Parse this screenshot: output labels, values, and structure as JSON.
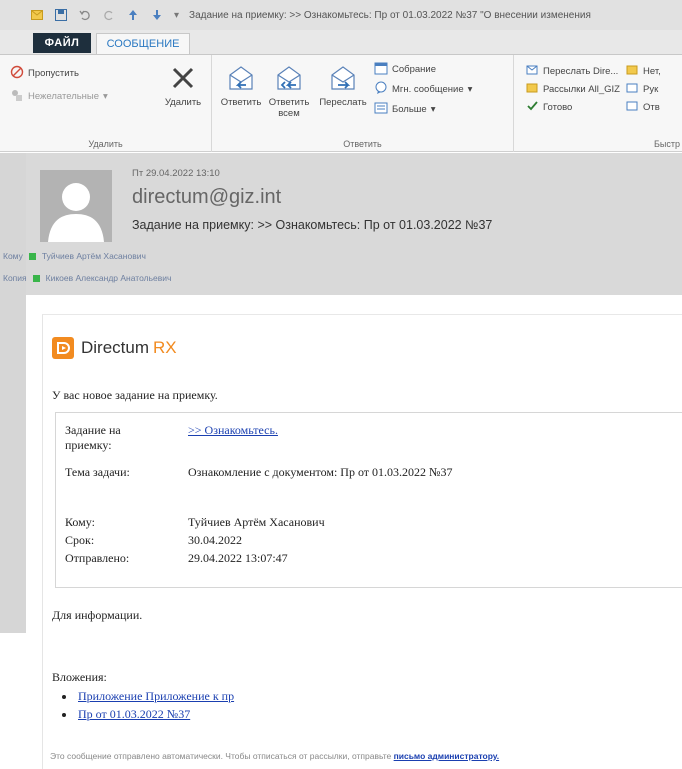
{
  "window": {
    "title": "Задание на приемку: >> Ознакомьтесь: Пр от 01.03.2022 №37 \"О внесении изменения"
  },
  "tabs": {
    "file": "ФАЙЛ",
    "message": "СООБЩЕНИЕ"
  },
  "ribbon": {
    "delete_group": {
      "ignore": "Пропустить",
      "junk": "Нежелательные",
      "delete": "Удалить",
      "label": "Удалить"
    },
    "respond_group": {
      "reply": "Ответить",
      "reply_all_1": "Ответить",
      "reply_all_2": "всем",
      "forward": "Переслать",
      "meeting": "Собрание",
      "im": "Мгн. сообщение",
      "more": "Больше",
      "label": "Ответить"
    },
    "quick_group": {
      "fwd_dir": "Переслать Dire...",
      "team": "Рассылки All_GIZ",
      "done": "Готово",
      "no": "Нет,",
      "lead": "Рук",
      "reply": "Отв",
      "label": "Быстр"
    }
  },
  "header": {
    "date": "Пт 29.04.2022 13:10",
    "sender": "directum@giz.int",
    "subject": "Задание на приемку: >> Ознакомьтесь: Пр от 01.03.2022 №37",
    "to_label": "Кому",
    "to_name": "Туйчиев Артём Хасанович",
    "cc_label": "Копия",
    "cc_name": "Кикоев Александр Анатольевич"
  },
  "body": {
    "logo_text": "Directum",
    "logo_rx": "RX",
    "intro": "У вас новое задание на приемку.",
    "task_label_1": "Задание на",
    "task_label_2": "приемку:",
    "task_link": ">> Ознакомьтесь.",
    "topic_label": "Тема задачи:",
    "topic_value": "Ознакомление с документом: Пр от 01.03.2022 №37",
    "to_label": "Кому:",
    "to_value": "Туйчиев Артём Хасанович",
    "due_label": "Срок:",
    "due_value": "30.04.2022",
    "sent_label": "Отправлено:",
    "sent_value": "29.04.2022 13:07:47",
    "info": "Для информации.",
    "attachments_title": "Вложения:",
    "attachments": [
      "Приложение Приложение к пр",
      "Пр от 01.03.2022 №37"
    ],
    "footer_text": "Это сообщение отправлено автоматически. Чтобы отписаться от рассылки, отправьте",
    "footer_link": "письмо администратору."
  },
  "colors": {
    "accent": "#2b79c2",
    "file_tab": "#1e2f3d",
    "brand_orange": "#f28b20",
    "link": "#1a3fb0",
    "presence": "#39b54a"
  }
}
